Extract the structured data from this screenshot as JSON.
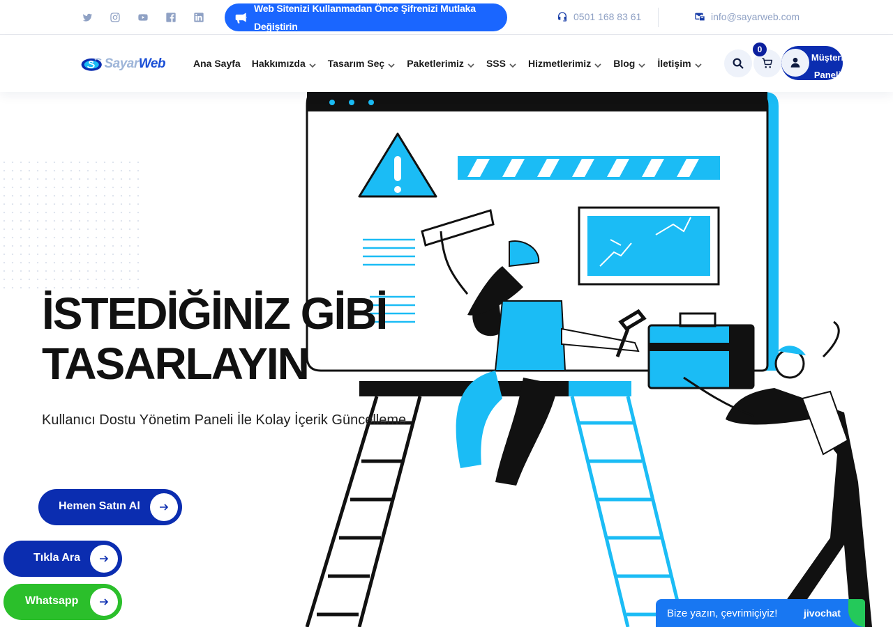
{
  "topbar": {
    "socials": [
      "twitter-icon",
      "instagram-icon",
      "youtube-icon",
      "facebook-icon",
      "linkedin-icon"
    ],
    "announcement": "Web Sitenizi Kullanmadan Önce Şifrenizi Mutlaka Değiştirin",
    "phone": "0501 168 83 61",
    "email": "info@sayarweb.com"
  },
  "header": {
    "logo": {
      "part1": "Sayar",
      "part2": "Web"
    },
    "nav": [
      {
        "label": "Ana Sayfa",
        "has_dropdown": false
      },
      {
        "label": "Hakkımızda",
        "has_dropdown": true
      },
      {
        "label": "Tasarım Seç",
        "has_dropdown": true
      },
      {
        "label": "Paketlerimiz",
        "has_dropdown": true
      },
      {
        "label": "SSS",
        "has_dropdown": true
      },
      {
        "label": "Hizmetlerimiz",
        "has_dropdown": true
      },
      {
        "label": "Blog",
        "has_dropdown": true
      },
      {
        "label": "İletişim",
        "has_dropdown": true
      }
    ],
    "cart_count": "0",
    "panel_label": "Müşteri Paneli"
  },
  "hero": {
    "title_line1": "İSTEDİĞİNİZ GİBİ",
    "title_line2": "TASARLAYIN",
    "subtitle": "Kullanıcı Dostu Yönetim Paneli İle Kolay İçerik Güncelleme",
    "buy_label": "Hemen Satın Al",
    "call_label": "Tıkla Ara",
    "whatsapp_label": "Whatsapp"
  },
  "chat": {
    "prompt": "Bize yazın, çevrimiçiyiz!",
    "brand": "jivochat"
  },
  "colors": {
    "primary": "#0b2db0",
    "accent_blue": "#1a66ff",
    "illustration_cyan": "#1bbcf5",
    "whatsapp_green": "#2bbf2b",
    "chat_blue": "#1877f2"
  }
}
